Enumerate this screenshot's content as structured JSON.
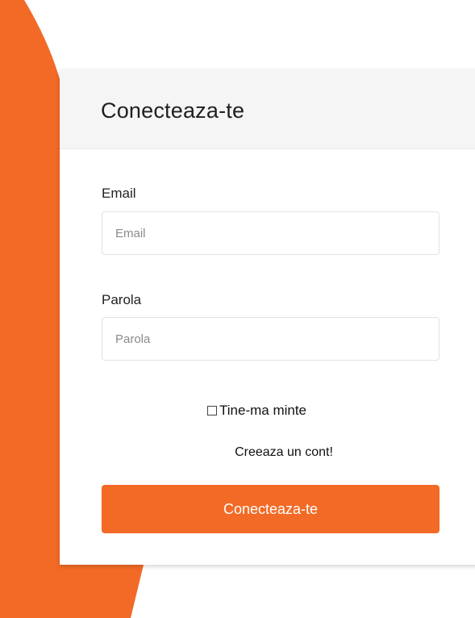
{
  "theme": {
    "accent": "#F26A25",
    "header_bg": "#F5F5F5"
  },
  "login_card": {
    "title": "Conecteaza-te",
    "email": {
      "label": "Email",
      "placeholder": "Email",
      "value": ""
    },
    "password": {
      "label": "Parola",
      "placeholder": "Parola",
      "value": ""
    },
    "remember_me": {
      "label": "Tine-ma minte",
      "checked": false
    },
    "register_link": "Creeaza un cont!",
    "submit_label": "Conecteaza-te"
  }
}
